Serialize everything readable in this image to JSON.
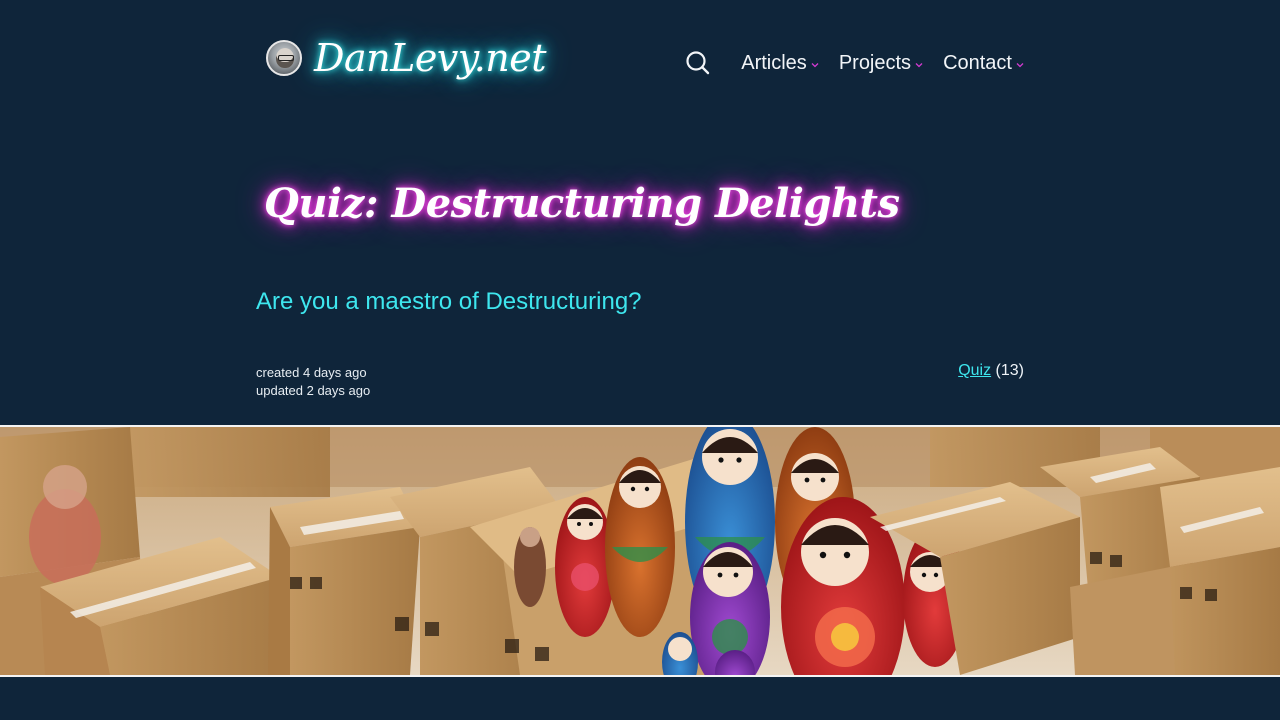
{
  "header": {
    "site_name": "DanLevy.net",
    "nav": {
      "search_icon": "search-icon",
      "items": [
        {
          "label": "Articles",
          "icon": "chevron-down-icon"
        },
        {
          "label": "Projects",
          "icon": "chevron-down-icon"
        },
        {
          "label": "Contact",
          "icon": "chevron-down-icon"
        }
      ]
    }
  },
  "post": {
    "title": "Quiz: Destructuring Delights",
    "subtitle": "Are you a maestro of Destructuring?",
    "created": "created 4 days ago",
    "updated": "updated 2 days ago",
    "tag": {
      "label": "Quiz",
      "count": "(13)"
    }
  },
  "colors": {
    "background": "#0f253a",
    "accent_cyan": "#3ee6ee",
    "accent_magenta": "#e62ad8",
    "chevron": "#d23ad0"
  }
}
